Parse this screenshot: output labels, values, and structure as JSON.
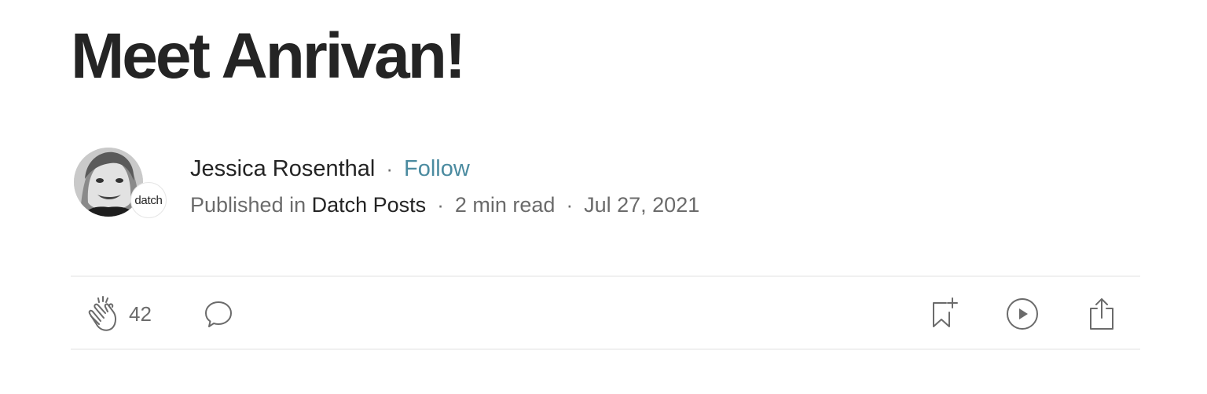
{
  "article": {
    "title": "Meet Anrivan!"
  },
  "author": {
    "name": "Jessica Rosenthal",
    "follow_label": "Follow",
    "avatar_icon": "author-portrait"
  },
  "publication": {
    "published_in_label": "Published in",
    "name": "Datch Posts",
    "badge_text": "datch"
  },
  "meta": {
    "read_time": "2 min read",
    "date": "Jul 27, 2021",
    "separator": "·"
  },
  "actions": {
    "clap_count": "42",
    "icons": [
      "clap-icon",
      "comment-icon",
      "bookmark-add-icon",
      "listen-play-icon",
      "share-icon"
    ]
  },
  "colors": {
    "follow": "#4b8ba0",
    "text": "#242424",
    "muted": "#6b6b6b",
    "divider": "#f0f0f0"
  }
}
